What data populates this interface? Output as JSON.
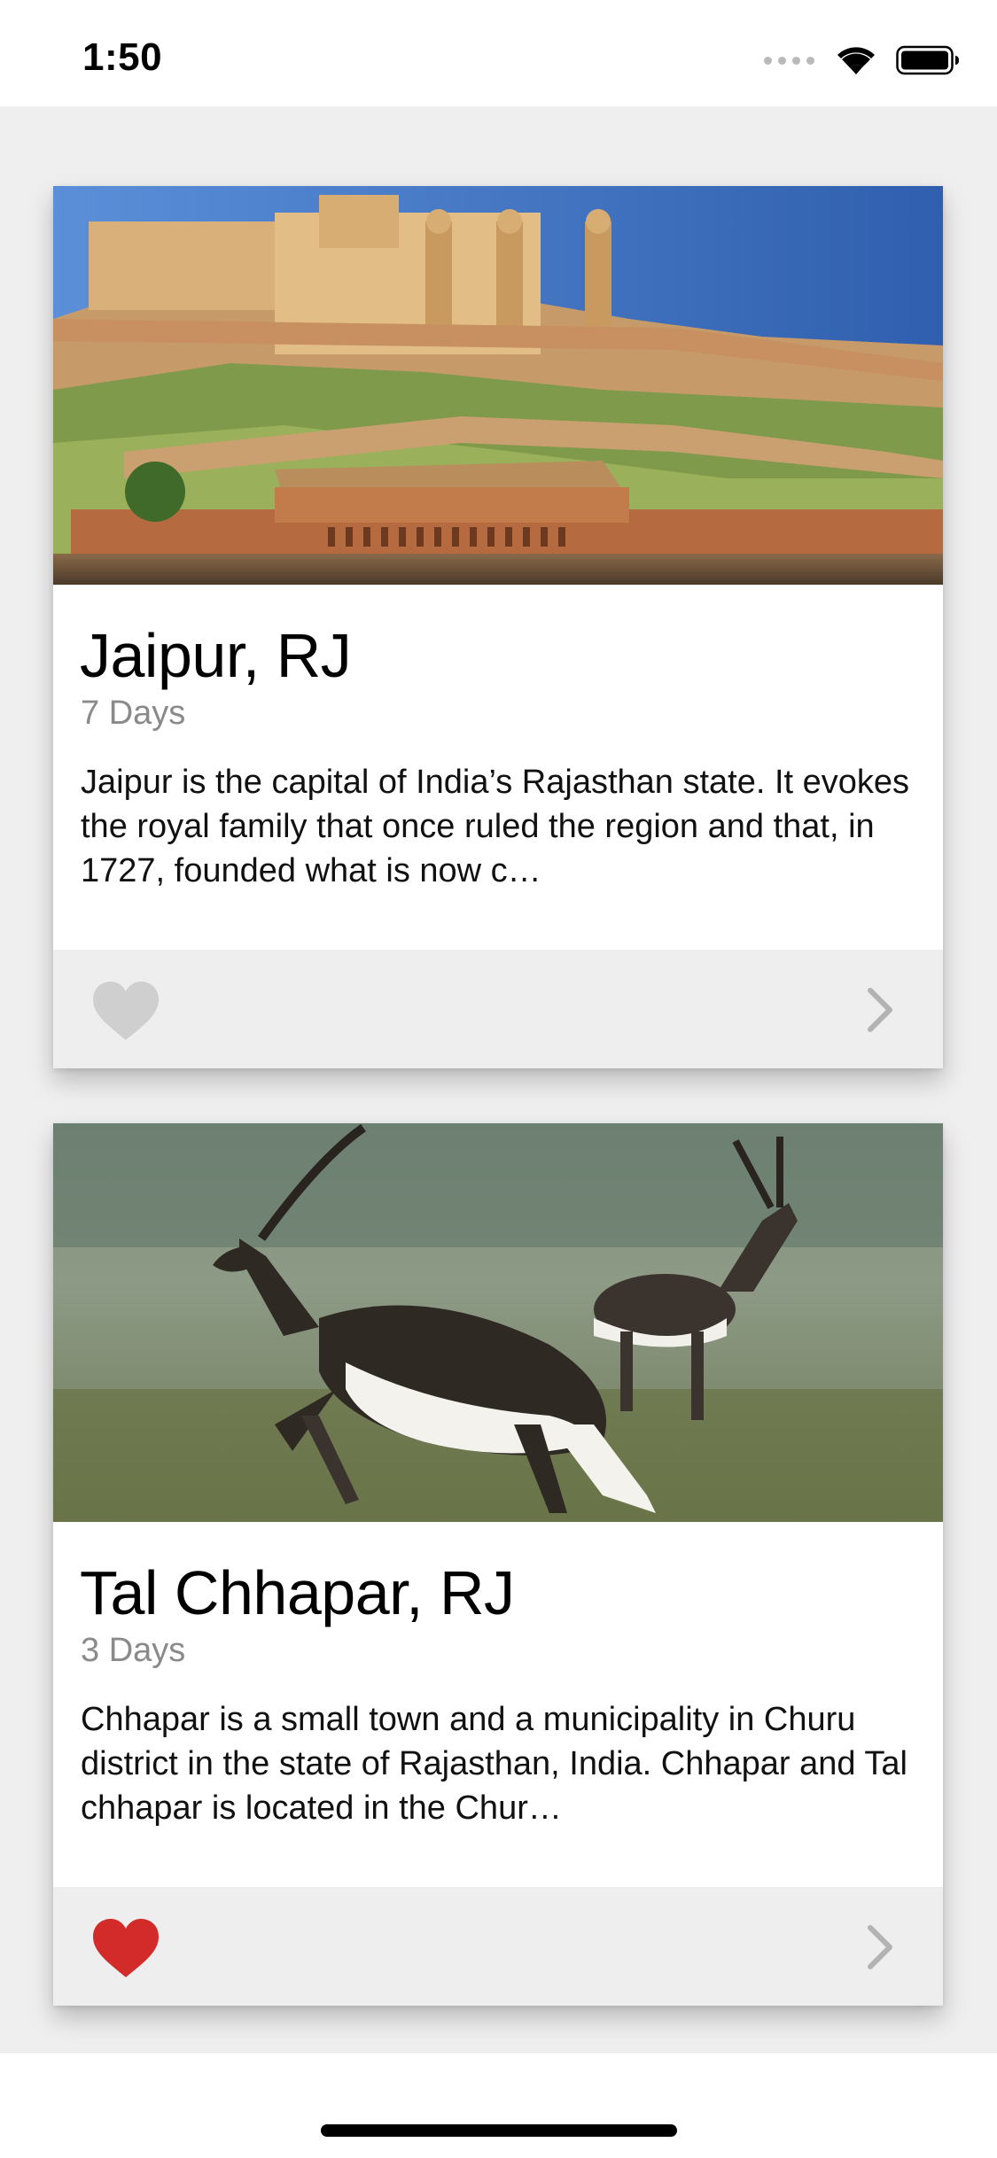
{
  "status_bar": {
    "time": "1:50",
    "signal_icon": "signal-dots-icon",
    "wifi_icon": "wifi-icon",
    "battery_icon": "battery-icon"
  },
  "cards": [
    {
      "title": "Jaipur, RJ",
      "subtitle": "7 Days",
      "description": "Jaipur is the capital of India’s Rajasthan state. It evokes the royal family that once ruled the region and that, in 1727, founded what is now c…",
      "image": "amber-fort-photo",
      "favorite": false,
      "favorite_color": "#cfcfcf",
      "chevron_icon": "chevron-right-icon"
    },
    {
      "title": "Tal Chhapar, RJ",
      "subtitle": "3 Days",
      "description": "Chhapar is a small town and a municipality in Churu district in the state of Rajasthan, India. Chhapar and Tal chhapar is located in the Chur…",
      "image": "blackbuck-photo",
      "favorite": true,
      "favorite_color": "#d32a2a",
      "chevron_icon": "chevron-right-icon"
    }
  ],
  "colors": {
    "background": "#efefef",
    "footer": "#eeeeee",
    "subtitle": "#8a8a8a",
    "chevron": "#b3b3b3"
  }
}
